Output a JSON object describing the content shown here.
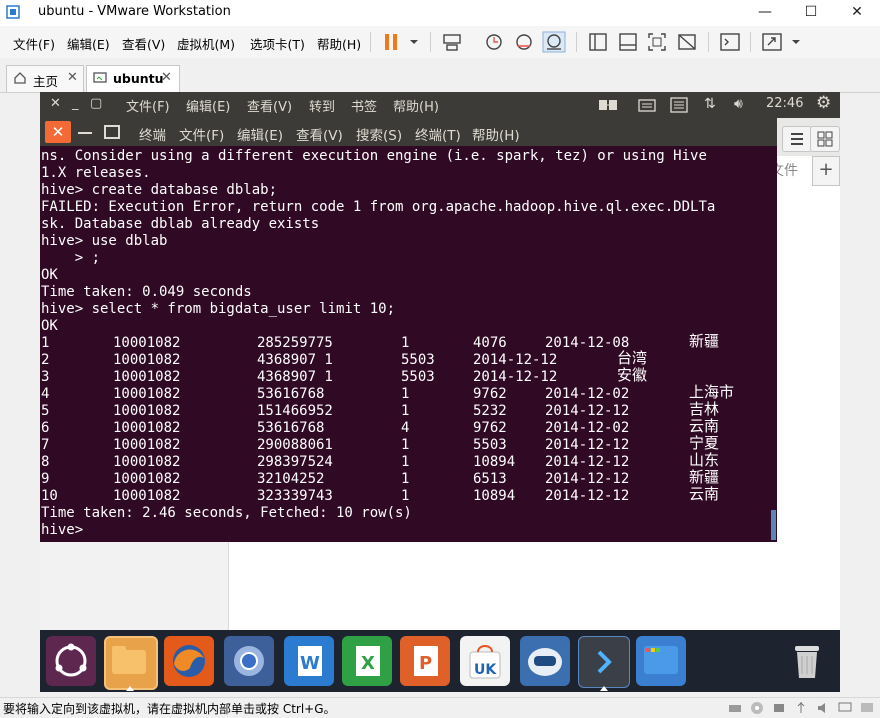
{
  "window": {
    "title": "ubuntu - VMware Workstation",
    "controls": {
      "minimize": "—",
      "maximize": "☐",
      "close": "✕"
    }
  },
  "menu": {
    "file": "文件(F)",
    "edit": "编辑(E)",
    "view": "查看(V)",
    "vm": "虚拟机(M)",
    "tabs": "选项卡(T)",
    "help": "帮助(H)"
  },
  "tabs": [
    {
      "label": "主页"
    },
    {
      "label": "ubuntu"
    }
  ],
  "ubuntu_panel": {
    "menus": [
      "文件(F)",
      "编辑(E)",
      "查看(V)",
      "转到",
      "书签",
      "帮助(H)"
    ],
    "clock": "22:46"
  },
  "background_window": {
    "tab_label": "文件"
  },
  "terminal": {
    "title": "终端",
    "menus": [
      "文件(F)",
      "编辑(E)",
      "查看(V)",
      "搜索(S)",
      "终端(T)",
      "帮助(H)"
    ],
    "lines": [
      "ns. Consider using a different execution engine (i.e. spark, tez) or using Hive",
      "1.X releases.",
      "hive> create database dblab;",
      "FAILED: Execution Error, return code 1 from org.apache.hadoop.hive.ql.exec.DDLTa",
      "sk. Database dblab already exists",
      "hive> use dblab",
      "    > ;",
      "OK",
      "Time taken: 0.049 seconds",
      "hive> select * from bigdata_user limit 10;",
      "OK"
    ],
    "rows": [
      {
        "id": "1",
        "user": "10001082",
        "item": "285259775",
        "behavior": "1",
        "cat": "4076",
        "date": "2014-12-08",
        "prov": "新疆"
      },
      {
        "id": "2",
        "user": "10001082",
        "item": "4368907 1",
        "behavior": "",
        "cat": "5503",
        "date": "2014-12-12",
        "prov": "台湾"
      },
      {
        "id": "3",
        "user": "10001082",
        "item": "4368907 1",
        "behavior": "",
        "cat": "5503",
        "date": "2014-12-12",
        "prov": "安徽"
      },
      {
        "id": "4",
        "user": "10001082",
        "item": "53616768",
        "behavior": "1",
        "cat": "9762",
        "date": "2014-12-02",
        "prov": "上海市"
      },
      {
        "id": "5",
        "user": "10001082",
        "item": "151466952",
        "behavior": "1",
        "cat": "5232",
        "date": "2014-12-12",
        "prov": "吉林"
      },
      {
        "id": "6",
        "user": "10001082",
        "item": "53616768",
        "behavior": "4",
        "cat": "9762",
        "date": "2014-12-02",
        "prov": "云南"
      },
      {
        "id": "7",
        "user": "10001082",
        "item": "290088061",
        "behavior": "1",
        "cat": "5503",
        "date": "2014-12-12",
        "prov": "宁夏"
      },
      {
        "id": "8",
        "user": "10001082",
        "item": "298397524",
        "behavior": "1",
        "cat": "10894",
        "date": "2014-12-12",
        "prov": "山东"
      },
      {
        "id": "9",
        "user": "10001082",
        "item": "32104252",
        "behavior": "1",
        "cat": "6513",
        "date": "2014-12-12",
        "prov": "新疆"
      },
      {
        "id": "10",
        "user": "10001082",
        "item": "323339743",
        "behavior": "1",
        "cat": "10894",
        "date": "2014-12-12",
        "prov": "云南"
      }
    ],
    "footer_lines": [
      "Time taken: 2.46 seconds, Fetched: 10 row(s)",
      "hive>"
    ]
  },
  "dock": {
    "items": [
      "ubuntu-dash",
      "files",
      "firefox",
      "chromium",
      "writer",
      "calc",
      "impress",
      "ubuntu-software",
      "amazon",
      "terminal",
      "workspace-switcher",
      "trash"
    ]
  },
  "statusbar": {
    "text": "要将输入定向到该虚拟机，请在虚拟机内部单击或按 Ctrl+G。"
  }
}
